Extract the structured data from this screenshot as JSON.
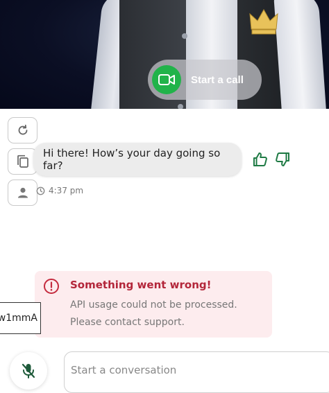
{
  "video": {
    "call_button_label": "Start a call",
    "call_icon": "video-camera-icon",
    "accent_green": "#21b34a"
  },
  "side_actions": [
    {
      "icon": "refresh-icon"
    },
    {
      "icon": "copy-icon"
    },
    {
      "icon": "user-avatar-icon"
    }
  ],
  "message": {
    "text": "Hi there! How’s your day going so far?",
    "time": "4:37 pm",
    "like_icon": "thumbs-up-icon",
    "dislike_icon": "thumbs-down-icon",
    "reaction_color": "#1e7a44"
  },
  "error": {
    "title": "Something went wrong!",
    "line1": "API usage could not be processed.",
    "line2": "Please contact support.",
    "icon": "alert-circle-icon",
    "title_color": "#b3263a",
    "background": "#fdecee"
  },
  "stray_tag": {
    "text": "w1mmA"
  },
  "composer": {
    "placeholder": "Start a conversation",
    "mic_icon": "mic-muted-icon"
  }
}
